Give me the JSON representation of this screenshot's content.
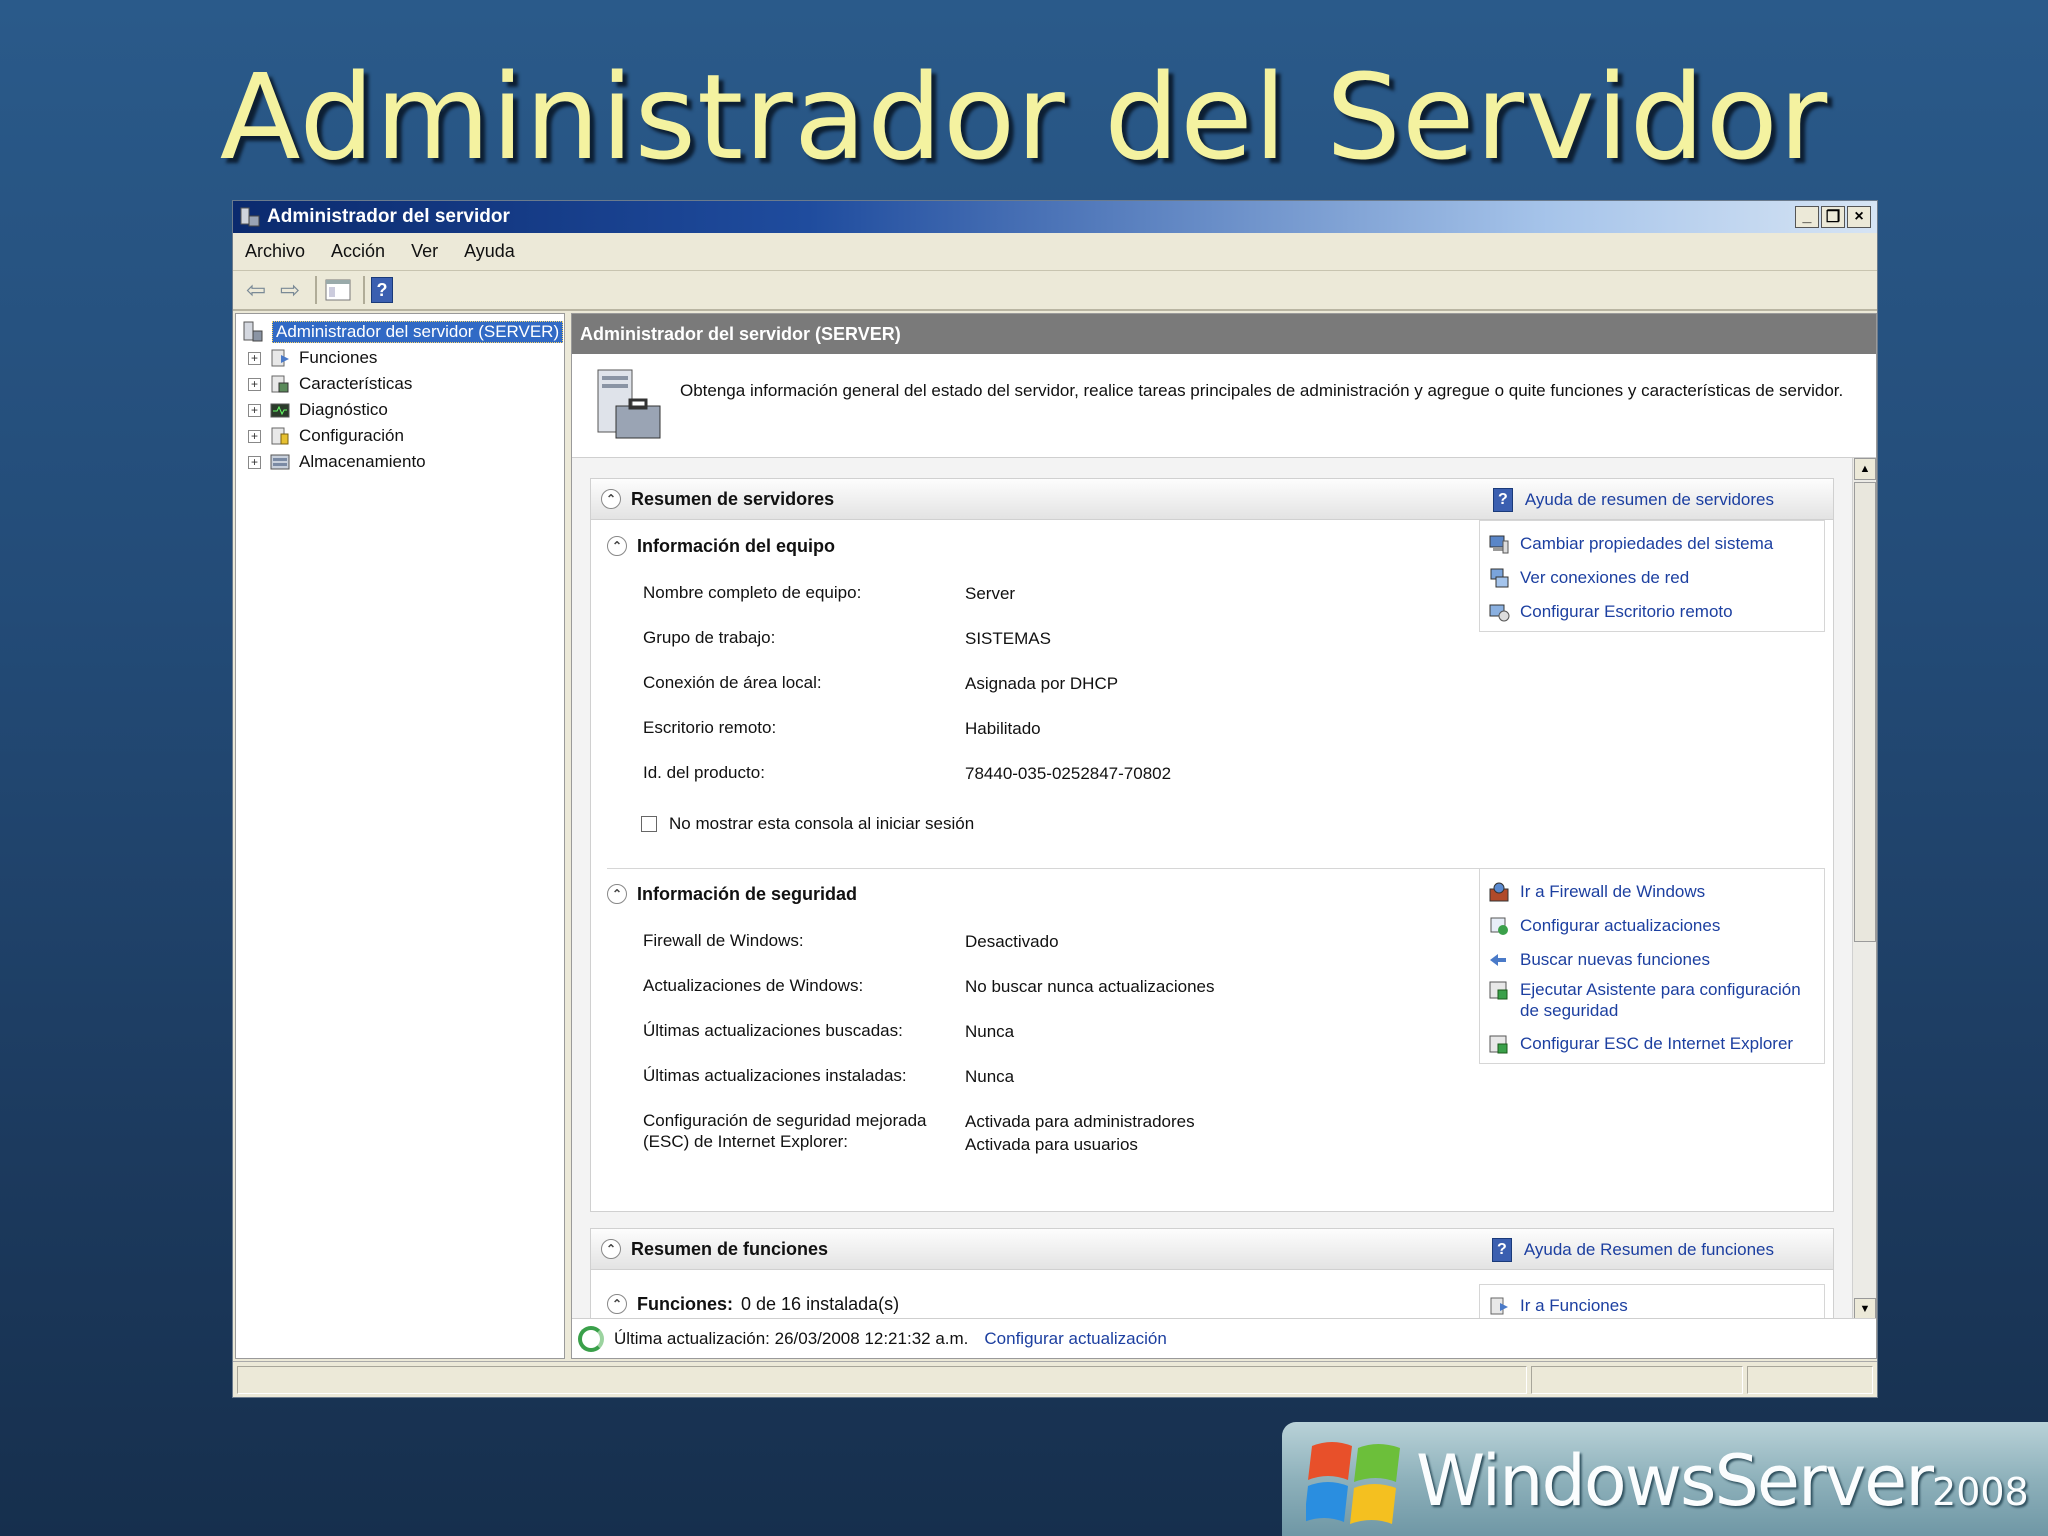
{
  "slide": {
    "title": "Administrador del Servidor"
  },
  "window": {
    "title": "Administrador del servidor",
    "controls": [
      "_",
      "3",
      "×"
    ]
  },
  "menu": [
    "Archivo",
    "Acción",
    "Ver",
    "Ayuda"
  ],
  "tree": {
    "root": "Administrador del servidor (SERVER)",
    "items": [
      "Funciones",
      "Características",
      "Diagnóstico",
      "Configuración",
      "Almacenamiento"
    ]
  },
  "pane": {
    "header": "Administrador del servidor (SERVER)",
    "intro": "Obtenga información general del estado del servidor, realice tareas principales de administración y agregue o quite funciones y características de servidor."
  },
  "server_summary": {
    "title": "Resumen de servidores",
    "help_link": "Ayuda de resumen de servidores",
    "computer_info": {
      "title": "Información del equipo",
      "rows": [
        {
          "label": "Nombre completo de equipo:",
          "value": "Server"
        },
        {
          "label": "Grupo de trabajo:",
          "value": "SISTEMAS"
        },
        {
          "label": "Conexión de área local:",
          "value": "Asignada por DHCP"
        },
        {
          "label": "Escritorio remoto:",
          "value": "Habilitado"
        },
        {
          "label": "Id. del producto:",
          "value": "78440-035-0252847-70802"
        }
      ],
      "checkbox_label": "No mostrar esta consola al iniciar sesión",
      "links": [
        "Cambiar propiedades del sistema",
        "Ver conexiones de red",
        "Configurar Escritorio remoto"
      ]
    },
    "security_info": {
      "title": "Información de seguridad",
      "rows": [
        {
          "label": "Firewall de Windows:",
          "value": "Desactivado"
        },
        {
          "label": "Actualizaciones de Windows:",
          "value": "No buscar nunca actualizaciones"
        },
        {
          "label": "Últimas actualizaciones buscadas:",
          "value": "Nunca"
        },
        {
          "label": "Últimas actualizaciones instaladas:",
          "value": "Nunca"
        },
        {
          "label": "Configuración de seguridad mejorada (ESC) de Internet Explorer:",
          "value": "Activada para administradores",
          "value2": "Activada para usuarios"
        }
      ],
      "links": [
        "Ir a Firewall de Windows",
        "Configurar actualizaciones",
        "Buscar nuevas funciones",
        "Ejecutar Asistente para configuración de seguridad",
        "Configurar ESC de Internet Explorer"
      ]
    }
  },
  "roles_summary": {
    "title": "Resumen de funciones",
    "help_link": "Ayuda de Resumen de funciones",
    "roles_label": "Funciones:",
    "roles_value": "0 de 16 instalada(s)",
    "roles_link": "Ir a Funciones"
  },
  "footer": {
    "last_update": "Última actualización: 26/03/2008 12:21:32 a.m.",
    "configure_link": "Configurar actualización"
  },
  "logo": {
    "text": "WindowsServer",
    "year": "2008"
  }
}
